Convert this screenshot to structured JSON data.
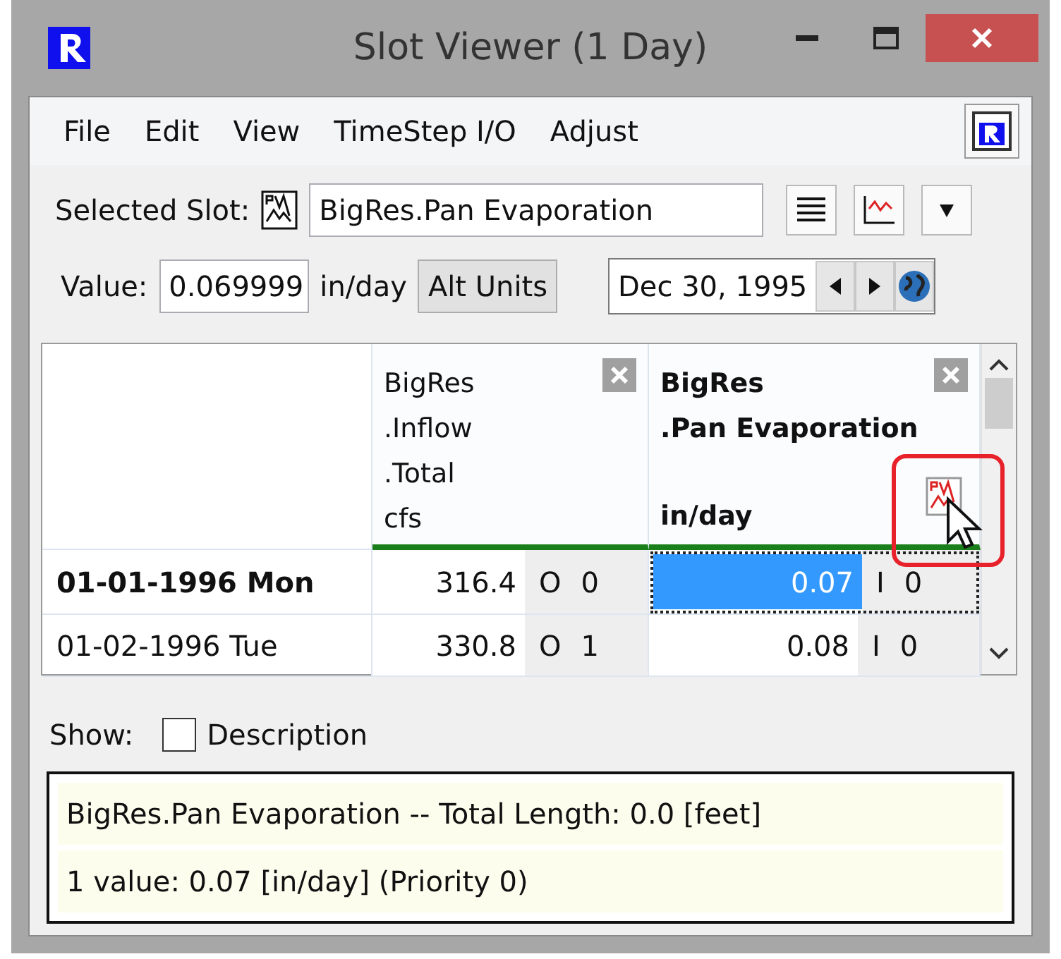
{
  "window": {
    "title": "Slot Viewer (1 Day)"
  },
  "menu": [
    "File",
    "Edit",
    "View",
    "TimeStep I/O",
    "Adjust"
  ],
  "selected_slot": {
    "label": "Selected Slot:",
    "value": "BigRes.Pan Evaporation"
  },
  "value_row": {
    "label": "Value:",
    "value": "0.069999",
    "units": "in/day",
    "alt_units": "Alt Units",
    "date": "Dec 30, 1995"
  },
  "table": {
    "columns": [
      {
        "lines": [
          "BigRes",
          ".Inflow",
          ".Total"
        ],
        "units": "cfs",
        "selected": false
      },
      {
        "lines": [
          "BigRes",
          ".Pan Evaporation"
        ],
        "units": "in/day",
        "selected": true
      }
    ],
    "rows": [
      {
        "date": "01-01-1996 Mon",
        "selected": true,
        "cells": [
          {
            "value": "316.4",
            "flag": "O",
            "priority": "0",
            "selected": false
          },
          {
            "value": "0.07",
            "flag": "I",
            "priority": "0",
            "selected": true
          }
        ]
      },
      {
        "date": "01-02-1996 Tue",
        "selected": false,
        "cells": [
          {
            "value": "330.8",
            "flag": "O",
            "priority": "1",
            "selected": false
          },
          {
            "value": "0.08",
            "flag": "I",
            "priority": "0",
            "selected": false
          }
        ]
      }
    ]
  },
  "show": {
    "label": "Show:",
    "option": {
      "label": "Description",
      "checked": false
    }
  },
  "info": [
    "BigRes.Pan Evaporation -- Total Length: 0.0 [feet]",
    "1 value:  0.07 [in/day]  (Priority 0)"
  ]
}
